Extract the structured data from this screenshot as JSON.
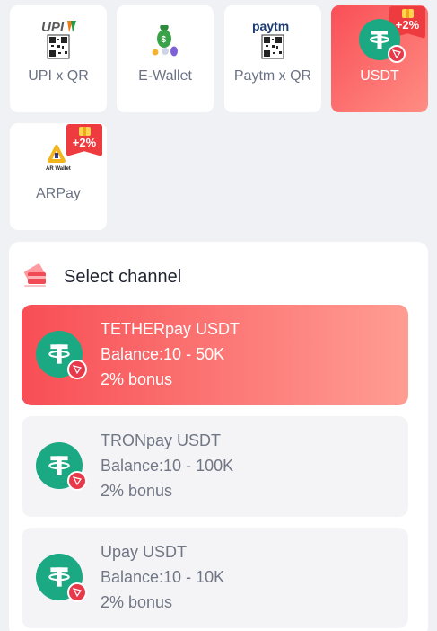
{
  "methods": [
    {
      "label": "UPI x QR",
      "logo_text": "UPI"
    },
    {
      "label": "E-Wallet"
    },
    {
      "label": "Paytm x QR",
      "logo_text": "paytm"
    },
    {
      "label": "USDT",
      "badge": "+2%"
    },
    {
      "label": "ARPay",
      "badge": "+2%",
      "logo_text": "AR Wallet"
    }
  ],
  "panel": {
    "title": "Select channel"
  },
  "channels": [
    {
      "name": "TETHERpay USDT",
      "balance": "Balance:10 - 50K",
      "bonus": "2% bonus",
      "selected": true
    },
    {
      "name": "TRONpay USDT",
      "balance": "Balance:10 - 100K",
      "bonus": "2% bonus",
      "selected": false
    },
    {
      "name": "Upay USDT",
      "balance": "Balance:10 - 10K",
      "bonus": "2% bonus",
      "selected": false
    }
  ],
  "colors": {
    "accent_start": "#f94f56",
    "accent_end": "#ff8d84",
    "usdt_green": "#1aa983",
    "tron_red": "#e8394b",
    "badge_red": "#ee3b3f"
  }
}
